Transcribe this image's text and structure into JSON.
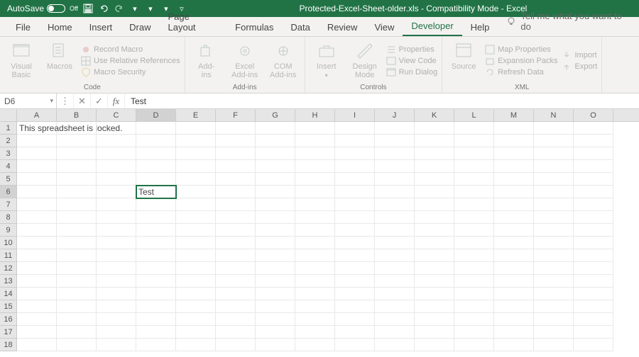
{
  "titlebar": {
    "autosave_label": "AutoSave",
    "autosave_state": "Off",
    "document_title": "Protected-Excel-Sheet-older.xls  -  Compatibility Mode  -  Excel"
  },
  "tabs": [
    {
      "label": "File"
    },
    {
      "label": "Home"
    },
    {
      "label": "Insert"
    },
    {
      "label": "Draw"
    },
    {
      "label": "Page Layout"
    },
    {
      "label": "Formulas"
    },
    {
      "label": "Data"
    },
    {
      "label": "Review"
    },
    {
      "label": "View"
    },
    {
      "label": "Developer",
      "active": true
    },
    {
      "label": "Help"
    }
  ],
  "tellme_placeholder": "Tell me what you want to do",
  "ribbon": {
    "code": {
      "visual_basic": "Visual\nBasic",
      "macros": "Macros",
      "record_macro": "Record Macro",
      "use_relative": "Use Relative References",
      "macro_security": "Macro Security",
      "group": "Code"
    },
    "addins": {
      "addins": "Add-\nins",
      "excel_addins": "Excel\nAdd-ins",
      "com_addins": "COM\nAdd-ins",
      "group": "Add-ins"
    },
    "controls": {
      "insert": "Insert",
      "design_mode": "Design\nMode",
      "properties": "Properties",
      "view_code": "View Code",
      "run_dialog": "Run Dialog",
      "group": "Controls"
    },
    "xml": {
      "source": "Source",
      "map_properties": "Map Properties",
      "expansion_packs": "Expansion Packs",
      "refresh_data": "Refresh Data",
      "import": "Import",
      "export": "Export",
      "group": "XML"
    }
  },
  "formula_bar": {
    "name_box": "D6",
    "fx": "fx",
    "formula": "Test"
  },
  "grid": {
    "columns": [
      "A",
      "B",
      "C",
      "D",
      "E",
      "F",
      "G",
      "H",
      "I",
      "J",
      "K",
      "L",
      "M",
      "N",
      "O"
    ],
    "selected_col": "D",
    "selected_row": 6,
    "row_count": 18,
    "cells": {
      "A1": "This spreadsheet is locked.",
      "D6": "Test"
    },
    "editing_cell": "D6"
  }
}
